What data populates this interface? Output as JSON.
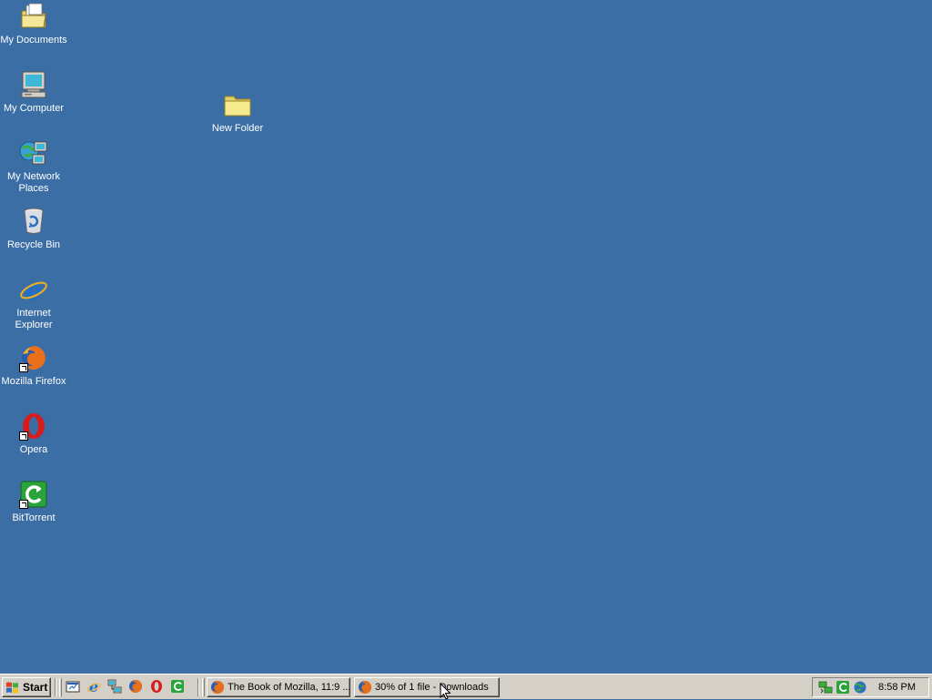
{
  "desktop": {
    "background_color": "#3a6ea5",
    "icons": [
      {
        "label": "My Documents",
        "icon": "my-documents-icon"
      },
      {
        "label": "My Computer",
        "icon": "my-computer-icon"
      },
      {
        "label": "My Network Places",
        "icon": "network-places-icon"
      },
      {
        "label": "Recycle Bin",
        "icon": "recycle-bin-icon"
      },
      {
        "label": "Internet Explorer",
        "icon": "internet-explorer-icon"
      },
      {
        "label": "Mozilla Firefox",
        "icon": "firefox-icon"
      },
      {
        "label": "Opera",
        "icon": "opera-icon"
      },
      {
        "label": "BitTorrent",
        "icon": "bittorrent-icon"
      },
      {
        "label": "New Folder",
        "icon": "folder-icon"
      }
    ]
  },
  "taskbar": {
    "start_label": "Start",
    "quick_launch": [
      "show-desktop-icon",
      "internet-explorer-icon",
      "network-icon",
      "firefox-icon",
      "opera-icon",
      "bittorrent-icon"
    ],
    "tasks": [
      {
        "label": "The Book of Mozilla, 11:9 ...",
        "icon": "firefox-icon"
      },
      {
        "label": "30% of 1 file - Downloads",
        "icon": "firefox-icon"
      }
    ],
    "tray_icons": [
      "network-tray-icon",
      "bittorrent-tray-icon",
      "globe-tray-icon"
    ],
    "clock": "8:58 PM"
  }
}
